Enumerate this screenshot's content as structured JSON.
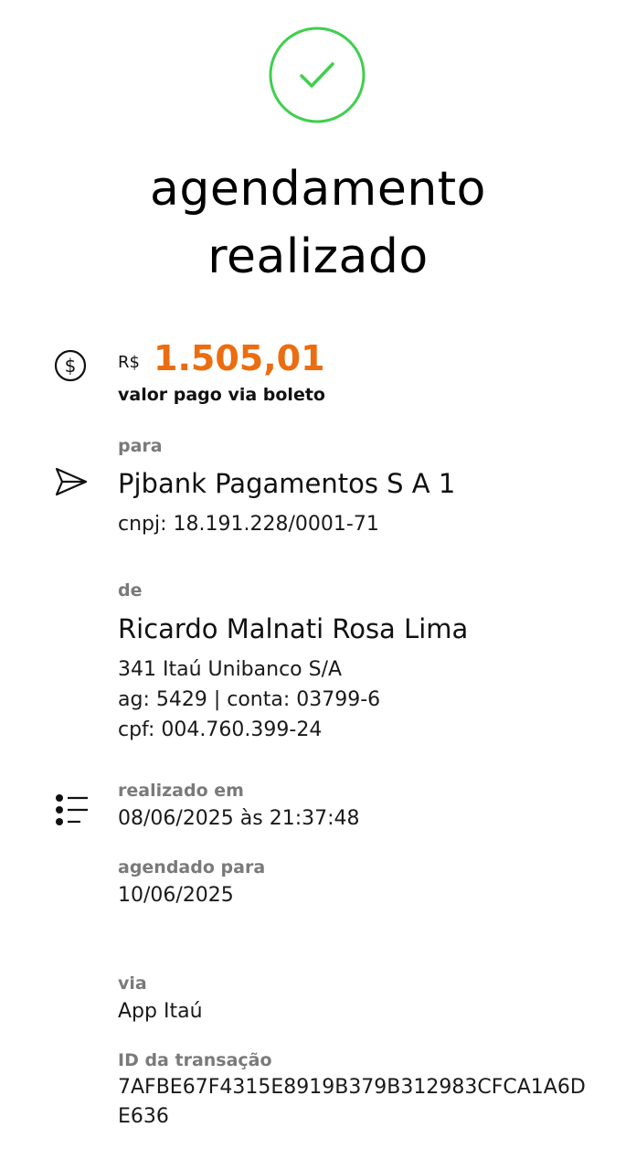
{
  "status": {
    "icon": "check-icon",
    "success_color": "#3fcf4e",
    "title_line1": "agendamento",
    "title_line2": "realizado"
  },
  "payment": {
    "icon": "dollar-coin-icon",
    "currency": "R$",
    "amount": "1.505,01",
    "amount_color": "#ec6c10",
    "caption": "valor pago via boleto"
  },
  "recipient": {
    "icon": "send-arrow-icon",
    "label": "para",
    "name": "Pjbank Pagamentos S A 1",
    "document": "cnpj: 18.191.228/0001-71"
  },
  "payer": {
    "label": "de",
    "name": "Ricardo Malnati Rosa Lima",
    "bank": "341 Itaú Unibanco S/A",
    "account": "ag: 5429 | conta: 03799-6",
    "document": "cpf: 004.760.399-24"
  },
  "details": {
    "icon": "list-icon",
    "performed_label": "realizado em",
    "performed_value": "08/06/2025 às 21:37:48",
    "scheduled_label": "agendado para",
    "scheduled_value": "10/06/2025",
    "channel_label": "via",
    "channel_value": "App Itaú",
    "transaction_label": "ID da transação",
    "transaction_id": "7AFBE67F4315E8919B379B312983CFCA1A6DE636"
  }
}
